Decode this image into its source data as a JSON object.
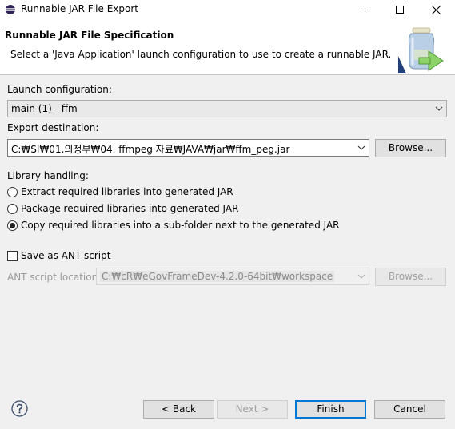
{
  "window": {
    "title": "Runnable JAR File Export",
    "minimize_icon": "minimize-icon",
    "maximize_icon": "maximize-icon",
    "close_icon": "close-icon"
  },
  "banner": {
    "title": "Runnable JAR File Specification",
    "description": "Select a 'Java Application' launch configuration to use to create a runnable JAR.",
    "icon": "jar-export-icon"
  },
  "launch": {
    "label": "Launch configuration:",
    "value": "main (1) - ffm"
  },
  "export": {
    "label": "Export destination:",
    "value": "C:₩SI₩01.의정부₩04. ffmpeg 자료₩JAVA₩jar₩ffm_peg.jar",
    "browse_label": "Browse..."
  },
  "library": {
    "label": "Library handling:",
    "options": [
      {
        "label": "Extract required libraries into generated JAR",
        "checked": false
      },
      {
        "label": "Package required libraries into generated JAR",
        "checked": false
      },
      {
        "label": "Copy required libraries into a sub-folder next to the generated JAR",
        "checked": true
      }
    ]
  },
  "ant": {
    "checkbox_label": "Save as ANT script",
    "checked": false,
    "location_label": "ANT script location:",
    "location_value": "C:₩cR₩eGovFrameDev-4.2.0-64bit₩workspace",
    "browse_label": "Browse..."
  },
  "footer": {
    "help_icon": "help-icon",
    "back_label": "< Back",
    "next_label": "Next >",
    "finish_label": "Finish",
    "cancel_label": "Cancel"
  },
  "colors": {
    "window_bg": "#f0f0f0",
    "banner_bg": "#ffffff",
    "default_button_border": "#0078d7"
  }
}
